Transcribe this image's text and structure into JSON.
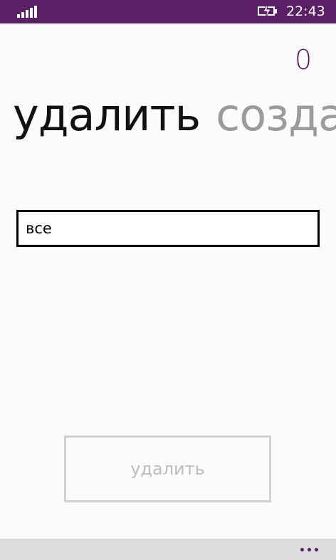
{
  "status_bar": {
    "time": "22:43",
    "signal_icon": "signal-strength-icon",
    "battery_icon": "battery-charging-icon"
  },
  "counter": {
    "value": "0"
  },
  "pivot": {
    "items": [
      {
        "label": "удалить",
        "active": true
      },
      {
        "label": "создать",
        "active": false
      }
    ]
  },
  "input": {
    "value": "все"
  },
  "actions": {
    "delete_label": "удалить"
  },
  "app_bar": {
    "more_icon": "more-ellipsis-icon"
  },
  "colors": {
    "accent": "#5a1f66",
    "background": "#fbfbfb",
    "app_bar": "#dcdcdc",
    "disabled": "#bdbdbd"
  }
}
